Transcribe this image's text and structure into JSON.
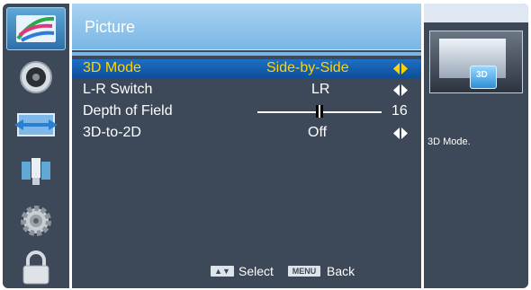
{
  "menu": {
    "title": "Picture",
    "items": [
      {
        "label": "3D Mode",
        "value": "Side-by-Side"
      },
      {
        "label": "L-R Switch",
        "value": "LR"
      },
      {
        "label": "Depth of Field",
        "value": "16"
      },
      {
        "label": "3D-to-2D",
        "value": "Off"
      }
    ],
    "selected_index": 0,
    "depth_slider": {
      "value": 16,
      "fraction": 0.5
    }
  },
  "sidebar": {
    "icons": [
      "picture-icon",
      "sound-icon",
      "screen-icon",
      "network-icon",
      "setup-icon",
      "lock-icon"
    ],
    "selected_index": 0
  },
  "footer": {
    "nav_keys": "▲▼",
    "select_label": "Select",
    "menu_key": "MENU",
    "back_label": "Back"
  },
  "info": {
    "badge": "3D",
    "description": "3D Mode."
  },
  "colors": {
    "panel_bg": "#3d4858",
    "titlebar": "#7ab6e4",
    "highlight": "#1565b8",
    "highlight_text": "#ffd400",
    "text": "#ffffff"
  }
}
